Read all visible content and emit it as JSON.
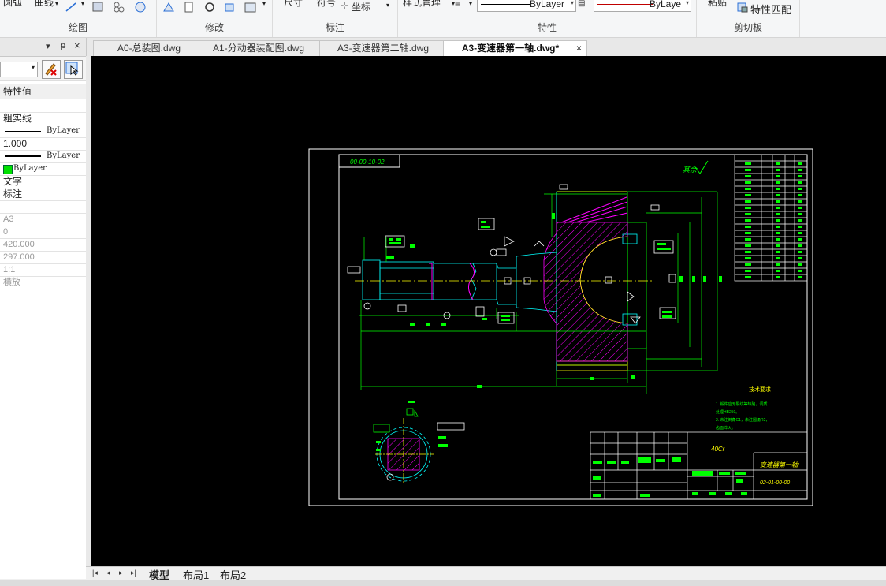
{
  "ribbon": {
    "groups": [
      {
        "label": "绘图",
        "buttons": [
          "圆弧",
          "曲线"
        ]
      },
      {
        "label": "修改"
      },
      {
        "label": "标注",
        "buttons": [
          "尺寸",
          "符号",
          "坐标"
        ]
      },
      {
        "label": "特性",
        "buttons": [
          "样式管理"
        ],
        "linetype_combo": "ByLayer",
        "color_combo": "ByLaye"
      },
      {
        "label": "剪切板",
        "buttons": [
          "粘贴",
          "特性匹配"
        ]
      }
    ]
  },
  "tabs": [
    {
      "label": "A0-总装图.dwg",
      "active": false
    },
    {
      "label": "A1-分动器装配图.dwg",
      "active": false
    },
    {
      "label": "A3-变速器第二轴.dwg",
      "active": false
    },
    {
      "label": "A3-变速器第一轴.dwg*",
      "active": true
    }
  ],
  "tab_close": "×",
  "panel": {
    "header_controls": [
      "▾",
      "ᵽ",
      "×"
    ],
    "column_header": "特性值",
    "rows": [
      {
        "text": "",
        "kind": "blank"
      },
      {
        "text": "粗实线",
        "kind": "text"
      },
      {
        "text": "ByLayer",
        "kind": "line"
      },
      {
        "text": "1.000",
        "kind": "text"
      },
      {
        "text": "ByLayer",
        "kind": "thickline"
      },
      {
        "text": "ByLayer",
        "kind": "color",
        "color": "#00e000"
      },
      {
        "text": "文字",
        "kind": "text"
      },
      {
        "text": "标注",
        "kind": "text"
      },
      {
        "text": "",
        "kind": "blank"
      },
      {
        "text": "A3",
        "kind": "gray"
      },
      {
        "text": "0",
        "kind": "gray"
      },
      {
        "text": "420.000",
        "kind": "gray"
      },
      {
        "text": "297.000",
        "kind": "gray"
      },
      {
        "text": "1:1",
        "kind": "gray"
      },
      {
        "text": "横放",
        "kind": "gray"
      }
    ]
  },
  "drawing": {
    "drawing_number_top": "00-00-10-02",
    "roughness_note": "其余",
    "tech_req_title": "技术要求",
    "tech_req_lines": [
      "1. 锻件应无裂纹等缺陷，调质",
      "处理HB250。",
      "2. 未注倒角C1，未注圆角R2，",
      "齿面淬火。"
    ],
    "material": "40Cr",
    "part_name": "变速器第一轴",
    "drawing_no": "02-01-00-00"
  },
  "layout_tabs": {
    "nav": [
      "|◂",
      "◂",
      "▸",
      "▸|"
    ],
    "tabs": [
      "模型",
      "布局1",
      "布局2"
    ],
    "active": "模型"
  },
  "colors": {
    "canvas": "#000000",
    "accent_green": "#00ff00",
    "cyan": "#00ffff",
    "magenta": "#ff00ff",
    "yellow": "#ffff00"
  }
}
